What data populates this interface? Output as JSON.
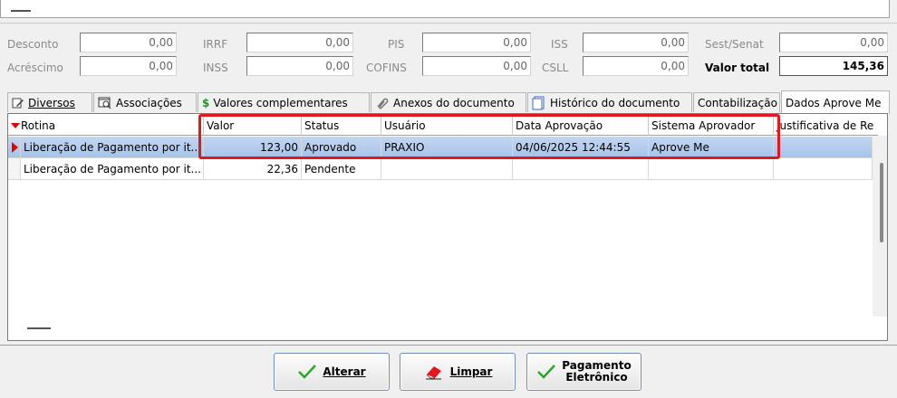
{
  "fields": {
    "desconto": {
      "label": "Desconto",
      "value": "0,00"
    },
    "acrescimo": {
      "label": "Acréscimo",
      "value": "0,00"
    },
    "irrf": {
      "label": "IRRF",
      "value": "0,00"
    },
    "inss": {
      "label": "INSS",
      "value": "0,00"
    },
    "pis": {
      "label": "PIS",
      "value": "0,00"
    },
    "cofins": {
      "label": "COFINS",
      "value": "0,00"
    },
    "iss": {
      "label": "ISS",
      "value": "0,00"
    },
    "csll": {
      "label": "CSLL",
      "value": "0,00"
    },
    "sest_senat": {
      "label": "Sest/Senat",
      "value": "0,00"
    },
    "valor_total": {
      "label": "Valor total",
      "value": "145,36"
    }
  },
  "tabs": [
    {
      "label": "Diversos",
      "icon": "pencil-icon",
      "active": false
    },
    {
      "label": "Associações",
      "icon": "window-search-icon",
      "active": false
    },
    {
      "label": "Valores complementares",
      "icon": "dollar-icon",
      "active": false
    },
    {
      "label": "Anexos do documento",
      "icon": "paperclip-icon",
      "active": false
    },
    {
      "label": "Histórico do documento",
      "icon": "document-icon",
      "active": false
    },
    {
      "label": "Contabilização",
      "icon": "",
      "active": false
    },
    {
      "label": "Dados Aprove Me",
      "icon": "",
      "active": true
    }
  ],
  "grid": {
    "columns": [
      "Rotina",
      "Valor",
      "Status",
      "Usuário",
      "Data Aprovação",
      "Sistema Aprovador",
      "Justificativa de Re"
    ],
    "rows": [
      {
        "rotina": "Liberação de Pagamento por it...",
        "valor": "123,00",
        "status": "Aprovado",
        "usuario": "PRAXIO",
        "data": "04/06/2025 12:44:55",
        "sistema": "Aprove Me",
        "justificativa": "",
        "selected": true
      },
      {
        "rotina": "Liberação de Pagamento por it...",
        "valor": "22,36",
        "status": "Pendente",
        "usuario": "",
        "data": "",
        "sistema": "",
        "justificativa": "",
        "selected": false
      }
    ]
  },
  "buttons": {
    "alterar": "Alterar",
    "limpar": "Limpar",
    "pagamento_line1": "Pagamento",
    "pagamento_line2": "Eletrônico"
  },
  "colors": {
    "highlight": "#e3171e",
    "selection": "#a6c2ea",
    "check": "#2aa52a"
  }
}
